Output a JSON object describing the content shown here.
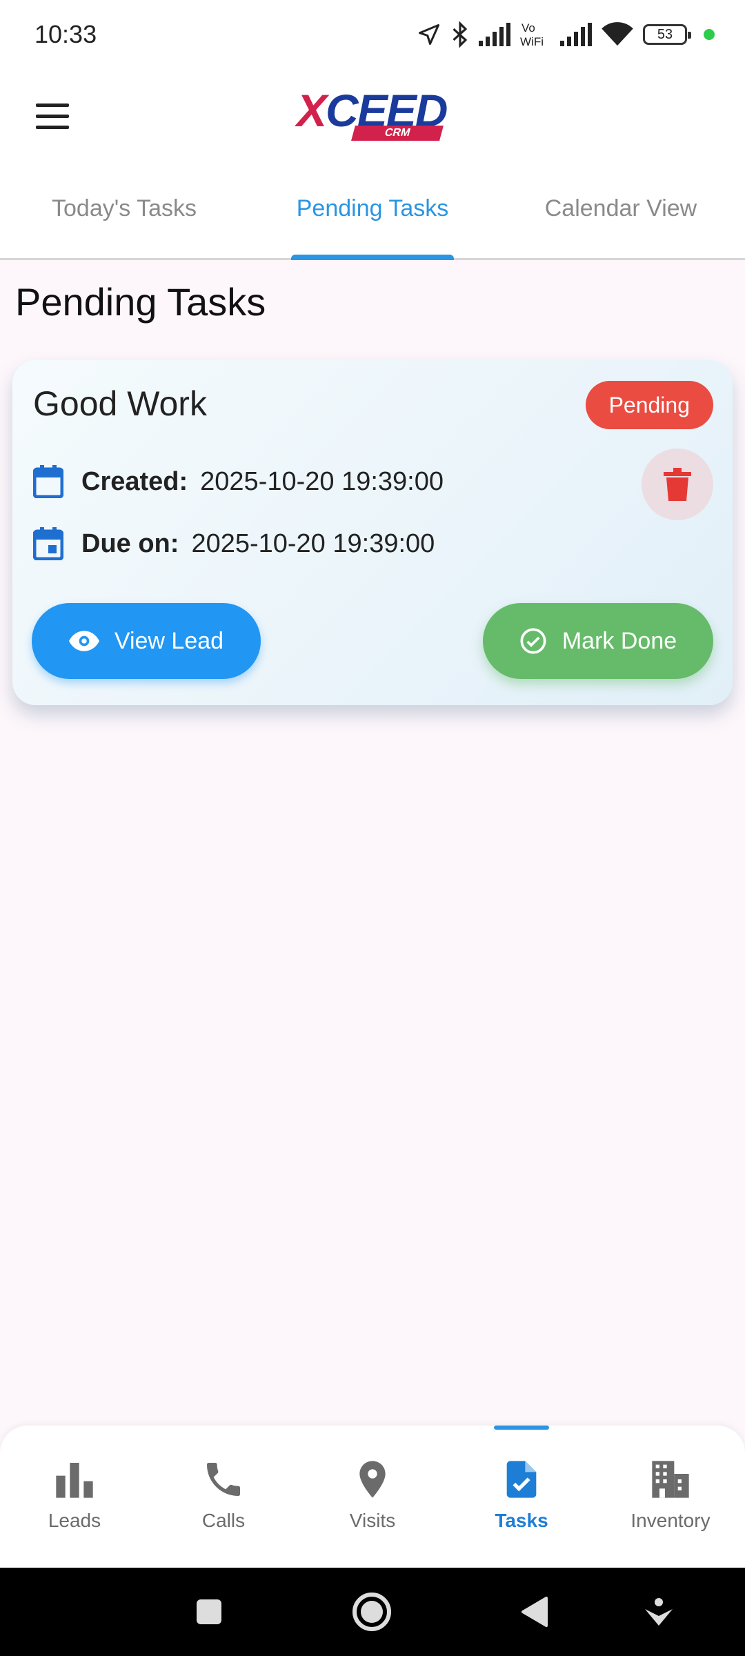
{
  "status_bar": {
    "time": "10:33",
    "battery": "53",
    "icons": [
      "location-arrow-icon",
      "bluetooth-icon",
      "signal-icon",
      "vowifi-icon",
      "signal-icon",
      "wifi-icon",
      "battery-icon"
    ]
  },
  "app_bar": {
    "logo_main": "CEED",
    "logo_x": "X",
    "logo_sub": "CRM",
    "menu_icon": "hamburger-menu-icon"
  },
  "tabs": [
    {
      "label": "Today's Tasks",
      "active": false
    },
    {
      "label": "Pending Tasks",
      "active": true
    },
    {
      "label": "Calendar View",
      "active": false
    }
  ],
  "page": {
    "title": "Pending Tasks"
  },
  "task": {
    "title": "Good Work",
    "status": "Pending",
    "created_label": "Created:",
    "created_value": "2025-10-20 19:39:00",
    "due_label": "Due on:",
    "due_value": "2025-10-20 19:39:00",
    "view_button": "View Lead",
    "done_button": "Mark Done"
  },
  "bottom_nav": [
    {
      "label": "Leads",
      "icon": "bar-chart-icon",
      "active": false
    },
    {
      "label": "Calls",
      "icon": "phone-icon",
      "active": false
    },
    {
      "label": "Visits",
      "icon": "location-pin-icon",
      "active": false
    },
    {
      "label": "Tasks",
      "icon": "task-document-icon",
      "active": true
    },
    {
      "label": "Inventory",
      "icon": "buildings-icon",
      "active": false
    }
  ],
  "colors": {
    "primary": "#2196f3",
    "success": "#66bb6a",
    "danger": "#ea4c42",
    "tab_active": "#2a95e2"
  }
}
